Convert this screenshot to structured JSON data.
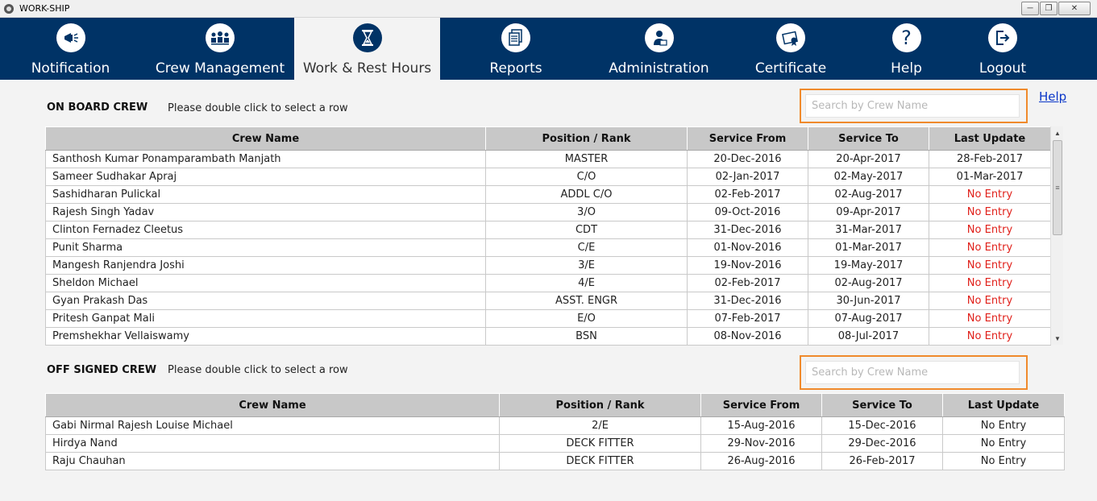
{
  "window": {
    "title": "WORK-SHIP"
  },
  "nav": {
    "items": [
      {
        "label": "Notification",
        "icon": "megaphone-icon"
      },
      {
        "label": "Crew Management",
        "icon": "crew-icon"
      },
      {
        "label": "Work & Rest Hours",
        "icon": "hourglass-icon",
        "active": true
      },
      {
        "label": "Reports",
        "icon": "reports-icon"
      },
      {
        "label": "Administration",
        "icon": "admin-icon"
      },
      {
        "label": "Certificate",
        "icon": "certificate-icon"
      },
      {
        "label": "Help",
        "icon": "question-icon"
      },
      {
        "label": "Logout",
        "icon": "logout-icon"
      }
    ]
  },
  "help_link": "Help",
  "onboard": {
    "title": "ON BOARD CREW",
    "hint": "Please double click to select a row",
    "search_placeholder": "Search by Crew Name",
    "columns": [
      "Crew Name",
      "Position / Rank",
      "Service From",
      "Service To",
      "Last Update"
    ],
    "rows": [
      [
        "Santhosh Kumar Ponamparambath  Manjath",
        "MASTER",
        "20-Dec-2016",
        "20-Apr-2017",
        "28-Feb-2017"
      ],
      [
        "Sameer Sudhakar Apraj",
        "C/O",
        "02-Jan-2017",
        "02-May-2017",
        "01-Mar-2017"
      ],
      [
        "Sashidharan  Pulickal",
        "ADDL C/O",
        "02-Feb-2017",
        "02-Aug-2017",
        "No Entry"
      ],
      [
        "Rajesh Singh Yadav",
        "3/O",
        "09-Oct-2016",
        "09-Apr-2017",
        "No Entry"
      ],
      [
        "Clinton Fernadez Cleetus",
        "CDT",
        "31-Dec-2016",
        "31-Mar-2017",
        "No Entry"
      ],
      [
        "Punit Sharma",
        "C/E",
        "01-Nov-2016",
        "01-Mar-2017",
        "No Entry"
      ],
      [
        "Mangesh Ranjendra Joshi",
        "3/E",
        "19-Nov-2016",
        "19-May-2017",
        "No Entry"
      ],
      [
        "Sheldon  Michael",
        "4/E",
        "02-Feb-2017",
        "02-Aug-2017",
        "No Entry"
      ],
      [
        "Gyan Prakash  Das",
        "ASST. ENGR",
        "31-Dec-2016",
        "30-Jun-2017",
        "No Entry"
      ],
      [
        "Pritesh Ganpat  Mali",
        "E/O",
        "07-Feb-2017",
        "07-Aug-2017",
        "No Entry"
      ],
      [
        "Premshekhar  Vellaiswamy",
        "BSN",
        "08-Nov-2016",
        "08-Jul-2017",
        "No Entry"
      ]
    ]
  },
  "offsigned": {
    "title": "OFF SIGNED CREW",
    "hint": "Please double click to select a row",
    "search_placeholder": "Search by Crew Name",
    "columns": [
      "Crew Name",
      "Position / Rank",
      "Service From",
      "Service To",
      "Last Update"
    ],
    "rows": [
      [
        "Gabi Nirmal Rajesh  Louise Michael",
        "2/E",
        "15-Aug-2016",
        "15-Dec-2016",
        "No Entry"
      ],
      [
        "Hirdya  Nand",
        "DECK FITTER",
        "29-Nov-2016",
        "29-Dec-2016",
        "No Entry"
      ],
      [
        "Raju  Chauhan",
        "DECK FITTER",
        "26-Aug-2016",
        "26-Feb-2017",
        "No Entry"
      ]
    ]
  },
  "colors": {
    "nav_bg": "#003366",
    "highlight": "#f08a2c",
    "no_entry": "#e0201a"
  }
}
